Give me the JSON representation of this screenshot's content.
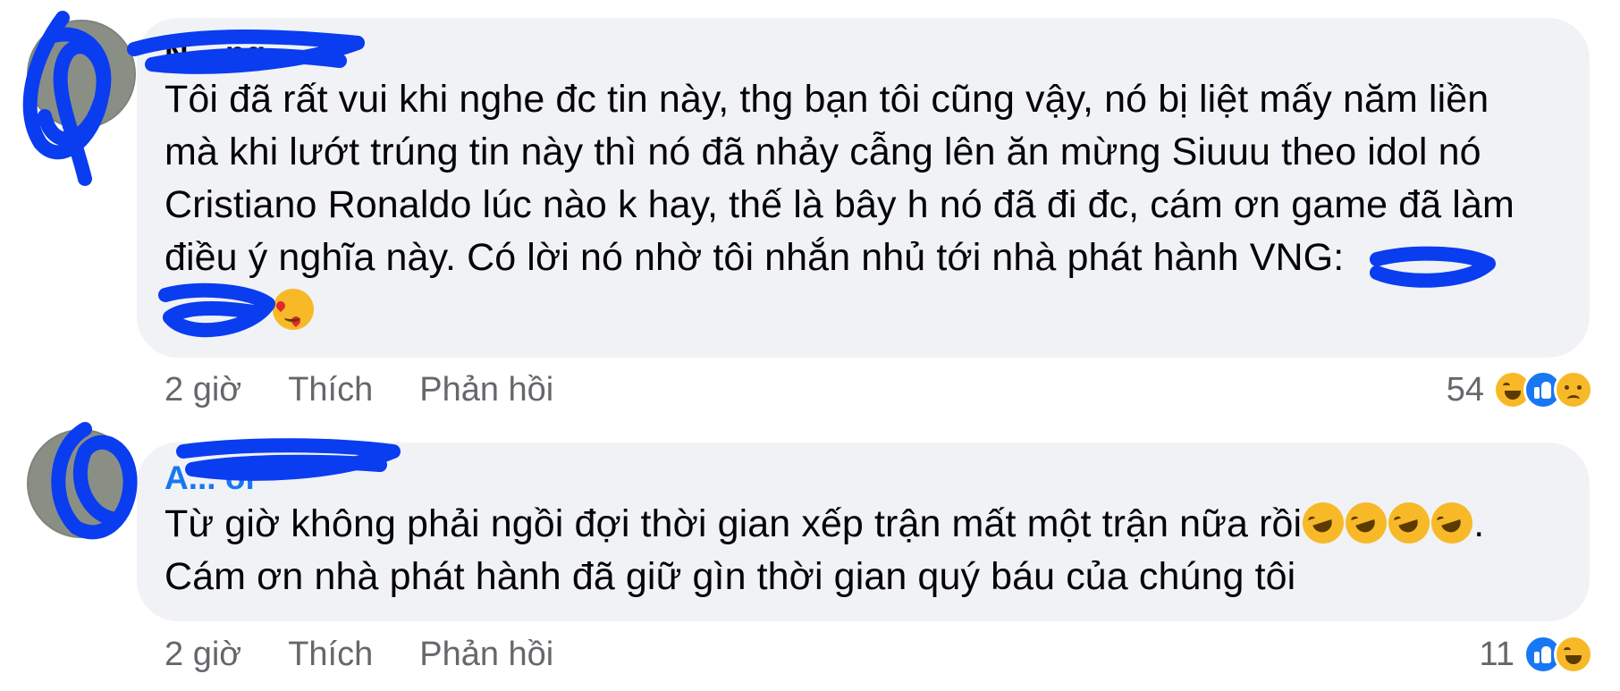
{
  "comments": [
    {
      "author": "N... ng",
      "text": "Tôi đã rất vui khi nghe đc tin này, thg bạn tôi cũng vậy, nó bị liệt mấy năm liền mà khi lướt trúng tin này thì nó đã nhảy cẫng lên ăn mừng Siuuu theo idol nó Cristiano Ronaldo lúc nào k hay, thế là bây h nó đã đi đc, cám ơn game đã làm điều ý nghĩa này. Có lời nó nhờ tôi nhắn nhủ tới nhà phát hành VNG:",
      "text_lines": [
        "Tôi đã rất vui khi nghe đc tin này, thg bạn tôi cũng vậy, nó bị liệt mấy năm liền",
        "mà khi lướt trúng tin này thì nó đã nhảy cẫng lên ăn mừng Siuuu theo idol nó",
        "Cristiano Ronaldo lúc nào k hay, thế là bây h nó đã đi đc, cám ơn game đã làm",
        "điều ý nghĩa này. Có lời nó nhờ tôi nhắn nhủ tới nhà phát hành VNG:"
      ],
      "time": "2 giờ",
      "like_label": "Thích",
      "reply_label": "Phản hồi",
      "reaction_count": "54",
      "reactions": [
        "haha-icon",
        "like-icon",
        "sad-icon"
      ],
      "inline_emoji": [
        "smiling-face-with-hearts-icon"
      ]
    },
    {
      "author": "A... ôi",
      "text": "Từ giờ không phải ngồi đợi thời gian xếp trận mất một trận nữa rồi🤣🤣🤣🤣. Cám ơn nhà phát hành đã giữ gìn thời gian quý báu của chúng tôi",
      "text_lines": [
        "Từ giờ không phải ngồi đợi thời gian xếp trận mất một trận nữa rồi",
        ".",
        "Cám ơn nhà phát hành đã giữ gìn thời gian quý báu của chúng tôi"
      ],
      "time": "2 giờ",
      "like_label": "Thích",
      "reply_label": "Phản hồi",
      "reaction_count": "11",
      "reactions": [
        "like-icon",
        "haha-icon"
      ],
      "inline_emoji": [
        "rofl-icon",
        "rofl-icon",
        "rofl-icon",
        "rofl-icon"
      ]
    }
  ],
  "colors": {
    "bubble": "#f0f2f5",
    "meta_text": "#65676b",
    "link_blue": "#1877f2",
    "scribble": "#0a3cf0"
  }
}
